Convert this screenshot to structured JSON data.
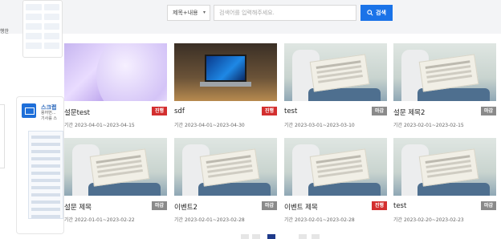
{
  "sidebar": {
    "fragment_text": "행한",
    "card_title": "스크랩",
    "card_sub_line1": "용어번...",
    "card_sub_line2": "기사를 스"
  },
  "search": {
    "select_value": "제목+내용",
    "placeholder": "검색어를 입력해주세요.",
    "button_label": "검색"
  },
  "cards": [
    {
      "title": "설문test",
      "badge": "진행",
      "period": "기간 2023-04-01~2023-04-15",
      "thumb": "abstract-purple"
    },
    {
      "title": "sdf",
      "badge": "진행",
      "period": "기간 2023-04-01~2023-04-30",
      "thumb": "laptop"
    },
    {
      "title": "test",
      "badge": "마감",
      "period": "기간 2023-03-01~2023-03-10",
      "thumb": "newspaper"
    },
    {
      "title": "설문 제목2",
      "badge": "마감",
      "period": "기간 2023-02-01~2023-02-15",
      "thumb": "newspaper"
    },
    {
      "title": "설문 제목",
      "badge": "마감",
      "period": "기간 2022-01-01~2023-02-22",
      "thumb": "newspaper"
    },
    {
      "title": "이벤트2",
      "badge": "마감",
      "period": "기간 2023-02-01~2023-02-28",
      "thumb": "newspaper"
    },
    {
      "title": "이벤트 제목",
      "badge": "진행",
      "period": "기간 2023-02-01~2023-02-28",
      "thumb": "newspaper"
    },
    {
      "title": "test",
      "badge": "마감",
      "period": "기간 2023-02-20~2023-02-23",
      "thumb": "newspaper"
    }
  ],
  "colors": {
    "accent": "#1a73e8",
    "badge_open": "#d32f2f",
    "badge_closed": "#8a8a8a",
    "pager_active": "#1f3a8a"
  }
}
